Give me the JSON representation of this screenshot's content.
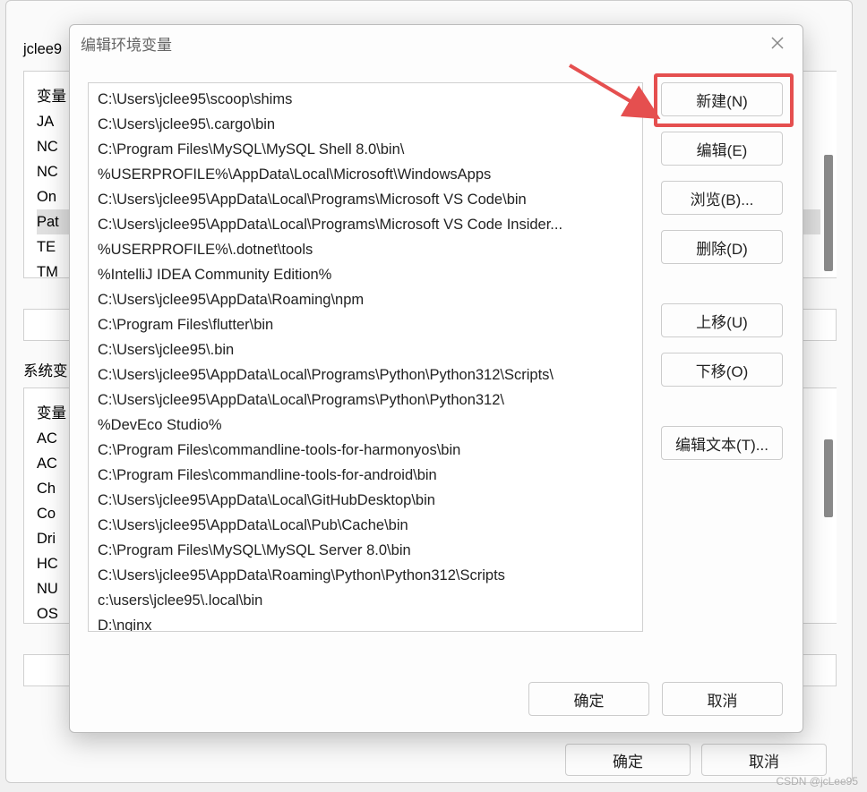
{
  "watermark": "CSDN @jcLee95",
  "parent": {
    "user_label_prefix": "jclee9",
    "system_label_prefix": "系统变",
    "ok": "确定",
    "cancel": "取消",
    "user_vars": [
      "变量",
      "JA",
      "NC",
      "NC",
      "On",
      "Pat",
      "TE",
      "TM"
    ],
    "sys_vars": [
      "变量",
      "AC",
      "AC",
      "Ch",
      "Co",
      "Dri",
      "HC",
      "NU",
      "OS"
    ]
  },
  "modal": {
    "title": "编辑环境变量",
    "paths": [
      "C:\\Users\\jclee95\\scoop\\shims",
      "C:\\Users\\jclee95\\.cargo\\bin",
      "C:\\Program Files\\MySQL\\MySQL Shell 8.0\\bin\\",
      "%USERPROFILE%\\AppData\\Local\\Microsoft\\WindowsApps",
      "C:\\Users\\jclee95\\AppData\\Local\\Programs\\Microsoft VS Code\\bin",
      "C:\\Users\\jclee95\\AppData\\Local\\Programs\\Microsoft VS Code Insider...",
      "%USERPROFILE%\\.dotnet\\tools",
      "%IntelliJ IDEA Community Edition%",
      "C:\\Users\\jclee95\\AppData\\Roaming\\npm",
      "C:\\Program Files\\flutter\\bin",
      "C:\\Users\\jclee95\\.bin",
      "C:\\Users\\jclee95\\AppData\\Local\\Programs\\Python\\Python312\\Scripts\\",
      "C:\\Users\\jclee95\\AppData\\Local\\Programs\\Python\\Python312\\",
      "%DevEco Studio%",
      "C:\\Program Files\\commandline-tools-for-harmonyos\\bin",
      "C:\\Program Files\\commandline-tools-for-android\\bin",
      "C:\\Users\\jclee95\\AppData\\Local\\GitHubDesktop\\bin",
      "C:\\Users\\jclee95\\AppData\\Local\\Pub\\Cache\\bin",
      "C:\\Program Files\\MySQL\\MySQL Server 8.0\\bin",
      "C:\\Users\\jclee95\\AppData\\Roaming\\Python\\Python312\\Scripts",
      "c:\\users\\jclee95\\.local\\bin",
      "D:\\nginx"
    ],
    "buttons": {
      "new": "新建(N)",
      "edit": "编辑(E)",
      "browse": "浏览(B)...",
      "delete": "删除(D)",
      "moveup": "上移(U)",
      "movedown": "下移(O)",
      "edittext": "编辑文本(T)..."
    },
    "ok": "确定",
    "cancel": "取消"
  }
}
